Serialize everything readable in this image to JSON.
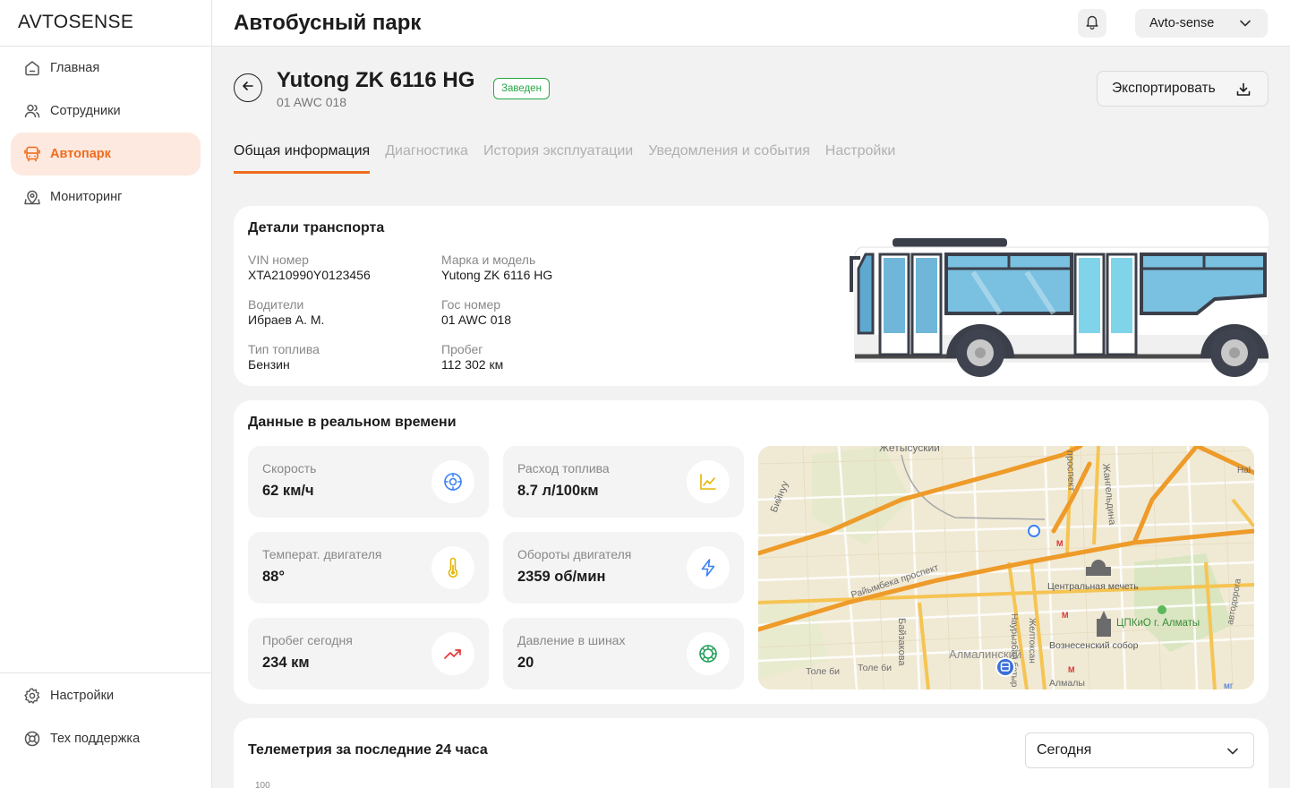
{
  "app": {
    "logo": "AVTOSENSE"
  },
  "sidebar": {
    "items": [
      {
        "label": "Главная",
        "icon": "home-icon"
      },
      {
        "label": "Сотрудники",
        "icon": "users-icon"
      },
      {
        "label": "Автопарк",
        "icon": "bus-icon",
        "active": true
      },
      {
        "label": "Мониторинг",
        "icon": "map-pin-icon"
      }
    ],
    "bottom": [
      {
        "label": "Настройки",
        "icon": "gear-icon"
      },
      {
        "label": "Тех поддержка",
        "icon": "lifebuoy-icon"
      }
    ]
  },
  "header": {
    "title": "Автобусный парк",
    "account": "Avto-sense"
  },
  "vehicle": {
    "name": "Yutong ZK 6116 HG",
    "plate": "01 AWC 018",
    "status": "Заведен",
    "export_label": "Экспортировать"
  },
  "tabs": [
    {
      "label": "Общая информация",
      "active": true
    },
    {
      "label": "Диагностика"
    },
    {
      "label": "История эксплуатации"
    },
    {
      "label": "Уведомления и события"
    },
    {
      "label": "Настройки"
    }
  ],
  "details": {
    "title": "Детали транспорта",
    "fields": [
      {
        "label": "VIN номер",
        "value": "XTA210990Y0123456"
      },
      {
        "label": "Марка и модель",
        "value": "Yutong ZK 6116 HG"
      },
      {
        "label": "Водители",
        "value": "Ибраев А. М."
      },
      {
        "label": "Гос номер",
        "value": "01 AWC 018"
      },
      {
        "label": "Тип топлива",
        "value": "Бензин"
      },
      {
        "label": "Пробег",
        "value": "112 302 км"
      }
    ]
  },
  "realtime": {
    "title": "Данные в реальном времени",
    "metrics": [
      {
        "label": "Скорость",
        "value": "62 км/ч",
        "icon": "speedometer-icon",
        "color": "#3b82f6"
      },
      {
        "label": "Расход топлива",
        "value": "8.7 л/100км",
        "icon": "chart-line-icon",
        "color": "#e5b500"
      },
      {
        "label": "Температ. двигателя",
        "value": "88°",
        "icon": "thermometer-icon",
        "color": "#e5b500"
      },
      {
        "label": "Обороты двигателя",
        "value": "2359 об/мин",
        "icon": "lightning-icon",
        "color": "#3b82f6"
      },
      {
        "label": "Пробег сегодня",
        "value": "234 км",
        "icon": "trend-up-icon",
        "color": "#e53935"
      },
      {
        "label": "Давление в шинах",
        "value": "20",
        "icon": "tire-icon",
        "color": "#22a05a"
      }
    ],
    "map": {
      "labels": [
        "Жетысуский",
        "Бийнуу",
        "проспект",
        "Жангельдина",
        "Райымбека проспект",
        "Центральная мечеть",
        "ЦПКиО г. Алматы",
        "Вознесенский собор",
        "Байзакова",
        "Наурызбай батыр",
        "Желтоксан",
        "Алмалинский",
        "Толе би",
        "Толе би",
        "Алмалы",
        "Hal",
        "автодорога",
        "мг"
      ]
    }
  },
  "telemetry": {
    "title": "Телеметрия за последние 24 часа",
    "period": "Сегодня",
    "y_top_tick": "100"
  }
}
